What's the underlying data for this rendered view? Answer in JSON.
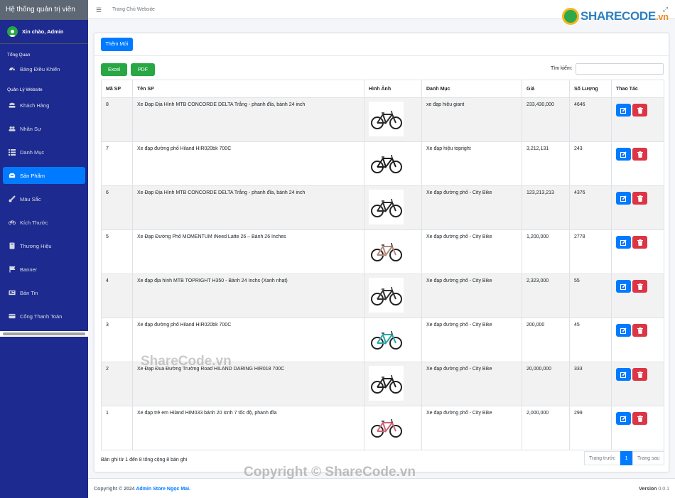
{
  "sidebar": {
    "brand": "Hệ thống quản trị viên",
    "greeting": "Xin chào, Admin",
    "section_overview": "Tổng Quan",
    "dashboard": "Bảng Điều Khiển",
    "section_manage": "Quản Lý Website",
    "items": [
      {
        "label": "Khách Hàng",
        "icon": "users-icon"
      },
      {
        "label": "Nhân Sự",
        "icon": "user-group-icon"
      },
      {
        "label": "Danh Mục",
        "icon": "list-icon"
      },
      {
        "label": "Sản Phẩm",
        "icon": "box-icon",
        "active": true
      },
      {
        "label": "Màu Sắc",
        "icon": "brush-icon"
      },
      {
        "label": "Kích Thước",
        "icon": "bicycle-icon"
      },
      {
        "label": "Thương Hiệu",
        "icon": "book-icon"
      },
      {
        "label": "Banner",
        "icon": "flag-icon"
      },
      {
        "label": "Bản Tin",
        "icon": "newspaper-icon"
      },
      {
        "label": "Cổng Thanh Toán",
        "icon": "credit-card-icon"
      }
    ]
  },
  "topbar": {
    "home_link": "Trang Chủ Website",
    "logo_main": "SHARECODE",
    "logo_suffix": ".vn"
  },
  "toolbar": {
    "add_label": "Thêm Mới",
    "excel_label": "Excel",
    "pdf_label": "PDF",
    "search_label": "Tìm kiếm:",
    "search_value": ""
  },
  "table": {
    "columns": [
      "Mã SP",
      "Tên SP",
      "Hình Ảnh",
      "Danh Mục",
      "Giá",
      "Số Lượng",
      "Thao Tác"
    ],
    "rows": [
      {
        "id": "8",
        "name": "Xe Đạp Địa Hình MTB CONCORDE DELTA Trắng - phanh đĩa, bánh 24 inch",
        "category": "xe đạp hiệu giant",
        "price": "233,430,000",
        "qty": "4646",
        "bike_color": "#2b2b2b"
      },
      {
        "id": "7",
        "name": "Xe đạp đường phố Hiland HIR020bk 700C",
        "category": "Xe đạp hiệu topright",
        "price": "3,212,131",
        "qty": "243",
        "bike_color": "#1a1a1a"
      },
      {
        "id": "6",
        "name": "Xe Đạp Địa Hình MTB CONCORDE DELTA Trắng - phanh đĩa, bánh 24 inch",
        "category": "Xe đạp đường phố - City Bike",
        "price": "123,213,213",
        "qty": "4376",
        "bike_color": "#2b2b2b"
      },
      {
        "id": "5",
        "name": "Xe Đạp Đường Phố MOMENTUM iNeed Latte 26 – Bánh 26 Inches",
        "category": "Xe đạp đường phố - City Bike",
        "price": "1,200,000",
        "qty": "2778",
        "bike_color": "#b08a7a"
      },
      {
        "id": "4",
        "name": "Xe đạp địa hình MTB TOPRIGHT H350 - Bánh 24 Inchs (Xanh nhạt)",
        "category": "Xe đạp đường phố - City Bike",
        "price": "2,323,000",
        "qty": "55",
        "bike_color": "#333333"
      },
      {
        "id": "3",
        "name": "Xe đạp đường phố Hiland HIR020bk 700C",
        "category": "Xe đạp đường phố - City Bike",
        "price": "200,000",
        "qty": "45",
        "bike_color": "#2aa6a6"
      },
      {
        "id": "2",
        "name": "Xe Đạp Đua Đường Trường Road HILAND DARING HIR018 700C",
        "category": "Xe đạp đường phố - City Bike",
        "price": "20,000,000",
        "qty": "333",
        "bike_color": "#222222"
      },
      {
        "id": "1",
        "name": "Xe đạp trẻ em Hiland HIM033 bánh 20 Icnh 7 tốc độ, phanh đĩa",
        "category": "Xe đạp đường phố - City Bike",
        "price": "2,000,000",
        "qty": "299",
        "bike_color": "#cc6677"
      }
    ]
  },
  "pagination": {
    "info": "Bản ghi từ 1 đến 8 tổng cộng 8 bản ghi",
    "prev": "Trang trước",
    "current": "1",
    "next": "Trang sau"
  },
  "footer": {
    "copyright_prefix": "Copyright © 2024",
    "store": "Admin Store Ngọc Mai.",
    "version_label": "Version",
    "version": "0.0.1"
  },
  "watermark": {
    "middle": "ShareCode.vn",
    "bottom": "Copyright © ShareCode.vn"
  },
  "colors": {
    "sidebar_bg": "#1d2a8f",
    "primary": "#007bff",
    "success": "#28a745",
    "danger": "#dc3545"
  }
}
